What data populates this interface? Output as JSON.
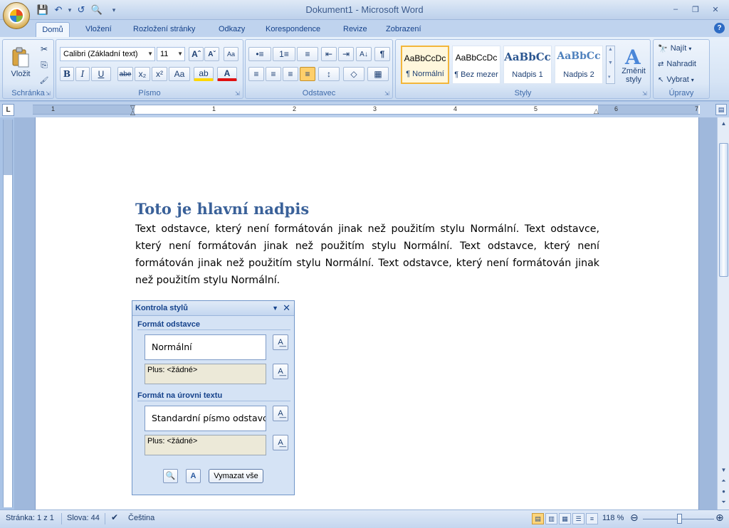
{
  "window": {
    "title": "Dokument1 - Microsoft Word",
    "minimize_icon": "–",
    "restore_icon": "❐",
    "close_icon": "✕"
  },
  "quick_access": {
    "save_icon": "💾",
    "undo_icon": "↶",
    "redo_icon": "↺",
    "print_preview_icon": "🔍",
    "customize_icon": "▾"
  },
  "tabs": [
    "Domů",
    "Vložení",
    "Rozložení stránky",
    "Odkazy",
    "Korespondence",
    "Revize",
    "Zobrazení"
  ],
  "help_icon": "?",
  "ribbon": {
    "clipboard": {
      "label": "Schránka",
      "paste_label": "Vložit",
      "cut_icon": "✂",
      "copy_icon": "⎘",
      "format_painter_icon": "🖌"
    },
    "font": {
      "label": "Písmo",
      "font_name": "Calibri (Základní text)",
      "font_size": "11",
      "grow_font": "Aˆ",
      "shrink_font": "Aˇ",
      "clear_format": "Aa",
      "bold": "B",
      "italic": "I",
      "underline": "U",
      "strike": "abe",
      "subscript": "x₂",
      "superscript": "x²",
      "change_case": "Aa",
      "highlight": "ab",
      "font_color": "A"
    },
    "paragraph": {
      "label": "Odstavec",
      "bullets": "•≡",
      "numbering": "1≡",
      "multilevel": "≡",
      "decrease_indent": "⇤",
      "increase_indent": "⇥",
      "sort": "A↓",
      "show_marks": "¶",
      "align_left": "≡",
      "align_center": "≡",
      "align_right": "≡",
      "justify": "≡",
      "line_spacing": "↕",
      "shading": "◇",
      "borders": "▦"
    },
    "styles": {
      "label": "Styly",
      "tiles": [
        {
          "sample": "AaBbCcDc",
          "name": "¶ Normální"
        },
        {
          "sample": "AaBbCcDc",
          "name": "¶ Bez mezer"
        },
        {
          "sample": "AaBbCc",
          "name": "Nadpis 1"
        },
        {
          "sample": "AaBbCc",
          "name": "Nadpis 2"
        }
      ],
      "change_styles_label": "Změnit styly"
    },
    "editing": {
      "label": "Úpravy",
      "find": "Najít",
      "replace": "Nahradit",
      "select": "Vybrat"
    }
  },
  "ruler": {
    "tab_selector": "L",
    "numbers": [
      "1",
      "1",
      "2",
      "3",
      "4",
      "5",
      "6",
      "7"
    ],
    "view_ruler_icon": "▤"
  },
  "document": {
    "heading": "Toto je hlavní nadpis",
    "body": "Text odstavce, který není formátován jinak než použitím stylu Normální. Text odstavce, který není formátován jinak než použitím stylu Normální. Text odstavce, který není formátován jinak než použitím stylu Normální. Text odstavce, který není formátován jinak než použitím stylu Normální."
  },
  "style_inspector": {
    "title": "Kontrola stylů",
    "paragraph_section": "Formát odstavce",
    "paragraph_style": "Normální",
    "paragraph_plus": "Plus: <žádné>",
    "text_section": "Formát na úrovni textu",
    "text_style": "Standardní písmo odstavce",
    "text_plus": "Plus: <žádné>",
    "clear_all_label": "Vymazat vše"
  },
  "statusbar": {
    "page": "Stránka: 1 z 1",
    "words": "Slova: 44",
    "language": "Čeština",
    "zoom": "118 %",
    "zoom_level_percent": 118
  },
  "colors": {
    "accent": "#3a6199",
    "ribbon": "#dce8f7",
    "highlight": "#ffd700",
    "font_color": "#e01010"
  }
}
